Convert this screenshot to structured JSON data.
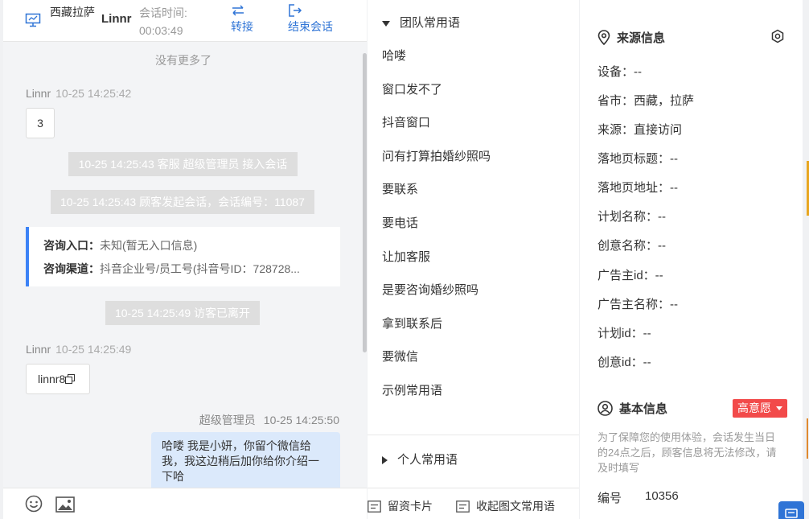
{
  "header": {
    "location": "西藏拉萨",
    "visitor_name": "Linnr",
    "session_time_label": "会话时间:",
    "session_time_value": "00:03:49",
    "transfer_label": "转接",
    "end_session_label": "结束会话"
  },
  "chat": {
    "no_more": "没有更多了",
    "msg1": {
      "sender": "Linnr",
      "time": "10-25 14:25:42",
      "text": "3"
    },
    "sys1": "10-25 14:25:43 客服 超级管理员 接入会话",
    "sys2": "10-25 14:25:43 顾客发起会话，会话编号：11087",
    "consult_entry_label": "咨询入口：",
    "consult_entry_value": "未知(暂无入口信息)",
    "consult_channel_label": "咨询渠道：",
    "consult_channel_value": "抖音企业号/员工号(抖音号ID：728728...",
    "sys3": "10-25 14:25:49 访客已离开",
    "msg2": {
      "sender": "Linnr",
      "time": "10-25 14:25:49",
      "text": "linnr8"
    },
    "msg3": {
      "sender": "超级管理员",
      "time": "10-25 14:25:50",
      "text": "哈喽 我是小妍，你留个微信给我，我这边稍后加你给你介绍一下哈"
    }
  },
  "footer_icons": [
    "emoji-icon",
    "image-icon"
  ],
  "phrases": {
    "team_group_label": "团队常用语",
    "items": [
      "哈喽",
      "窗口发不了",
      "抖音窗口",
      "问有打算拍婚纱照吗",
      "要联系",
      "要电话",
      "让加客服",
      "是要咨询婚纱照吗",
      "拿到联系后",
      "要微信",
      "示例常用语"
    ],
    "personal_group_label": "个人常用语",
    "card_label": "留资卡片",
    "collapse_label": "收起图文常用语"
  },
  "source_info": {
    "title": "来源信息",
    "fields": [
      "设备：--",
      "省市：西藏，拉萨",
      "来源：直接访问",
      "落地页标题：--",
      "落地页地址：--",
      "计划名称：--",
      "创意名称：--",
      "广告主id：--",
      "广告主名称：--",
      "计划id：--",
      "创意id：--"
    ]
  },
  "basic_info": {
    "title": "基本信息",
    "intent_badge": "高意愿",
    "notice": "为了保障您的使用体验，会话发生当日的24点之后，顾客信息将无法修改，请及时填写",
    "number_label": "编号",
    "number_value": "10356"
  },
  "colors": {
    "accent": "#2f74d6",
    "intent": "#f24a4a",
    "agent_bubble": "#dbe9fb"
  }
}
